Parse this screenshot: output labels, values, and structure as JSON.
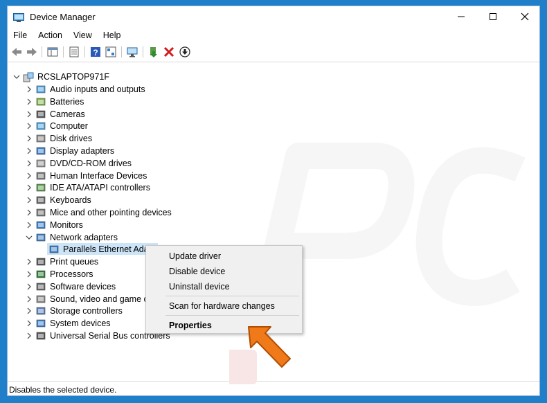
{
  "window": {
    "title": "Device Manager"
  },
  "menubar": {
    "items": [
      "File",
      "Action",
      "View",
      "Help"
    ]
  },
  "tree": {
    "root": "RCSLAPTOP971F",
    "categories": [
      {
        "label": "Audio inputs and outputs",
        "icon": "speaker-icon",
        "expanded": false
      },
      {
        "label": "Batteries",
        "icon": "battery-icon",
        "expanded": false
      },
      {
        "label": "Cameras",
        "icon": "camera-icon",
        "expanded": false
      },
      {
        "label": "Computer",
        "icon": "computer-icon",
        "expanded": false
      },
      {
        "label": "Disk drives",
        "icon": "disk-drive-icon",
        "expanded": false
      },
      {
        "label": "Display adapters",
        "icon": "display-adapter-icon",
        "expanded": false
      },
      {
        "label": "DVD/CD-ROM drives",
        "icon": "dvd-drive-icon",
        "expanded": false
      },
      {
        "label": "Human Interface Devices",
        "icon": "hid-icon",
        "expanded": false
      },
      {
        "label": "IDE ATA/ATAPI controllers",
        "icon": "ide-controller-icon",
        "expanded": false
      },
      {
        "label": "Keyboards",
        "icon": "keyboard-icon",
        "expanded": false
      },
      {
        "label": "Mice and other pointing devices",
        "icon": "mouse-icon",
        "expanded": false
      },
      {
        "label": "Monitors",
        "icon": "monitor-icon",
        "expanded": false
      },
      {
        "label": "Network adapters",
        "icon": "network-adapter-icon",
        "expanded": true
      },
      {
        "label": "Parallels Ethernet Ada",
        "icon": "network-adapter-icon",
        "child": true
      },
      {
        "label": "Print queues",
        "icon": "printer-icon",
        "expanded": false
      },
      {
        "label": "Processors",
        "icon": "processor-icon",
        "expanded": false
      },
      {
        "label": "Software devices",
        "icon": "software-device-icon",
        "expanded": false
      },
      {
        "label": "Sound, video and game c",
        "icon": "sound-icon",
        "expanded": false
      },
      {
        "label": "Storage controllers",
        "icon": "storage-controller-icon",
        "expanded": false
      },
      {
        "label": "System devices",
        "icon": "system-device-icon",
        "expanded": false
      },
      {
        "label": "Universal Serial Bus controllers",
        "icon": "usb-icon",
        "expanded": false
      }
    ]
  },
  "context_menu": {
    "update_driver": "Update driver",
    "disable_device": "Disable device",
    "uninstall_device": "Uninstall device",
    "scan_hardware": "Scan for hardware changes",
    "properties": "Properties"
  },
  "statusbar": {
    "text": "Disables the selected device."
  },
  "colors": {
    "frame_blue": "#1f7fc8",
    "selection": "#cce4f7",
    "arrow_orange": "#f07a1a",
    "menu_bg": "#f0f0f0"
  }
}
